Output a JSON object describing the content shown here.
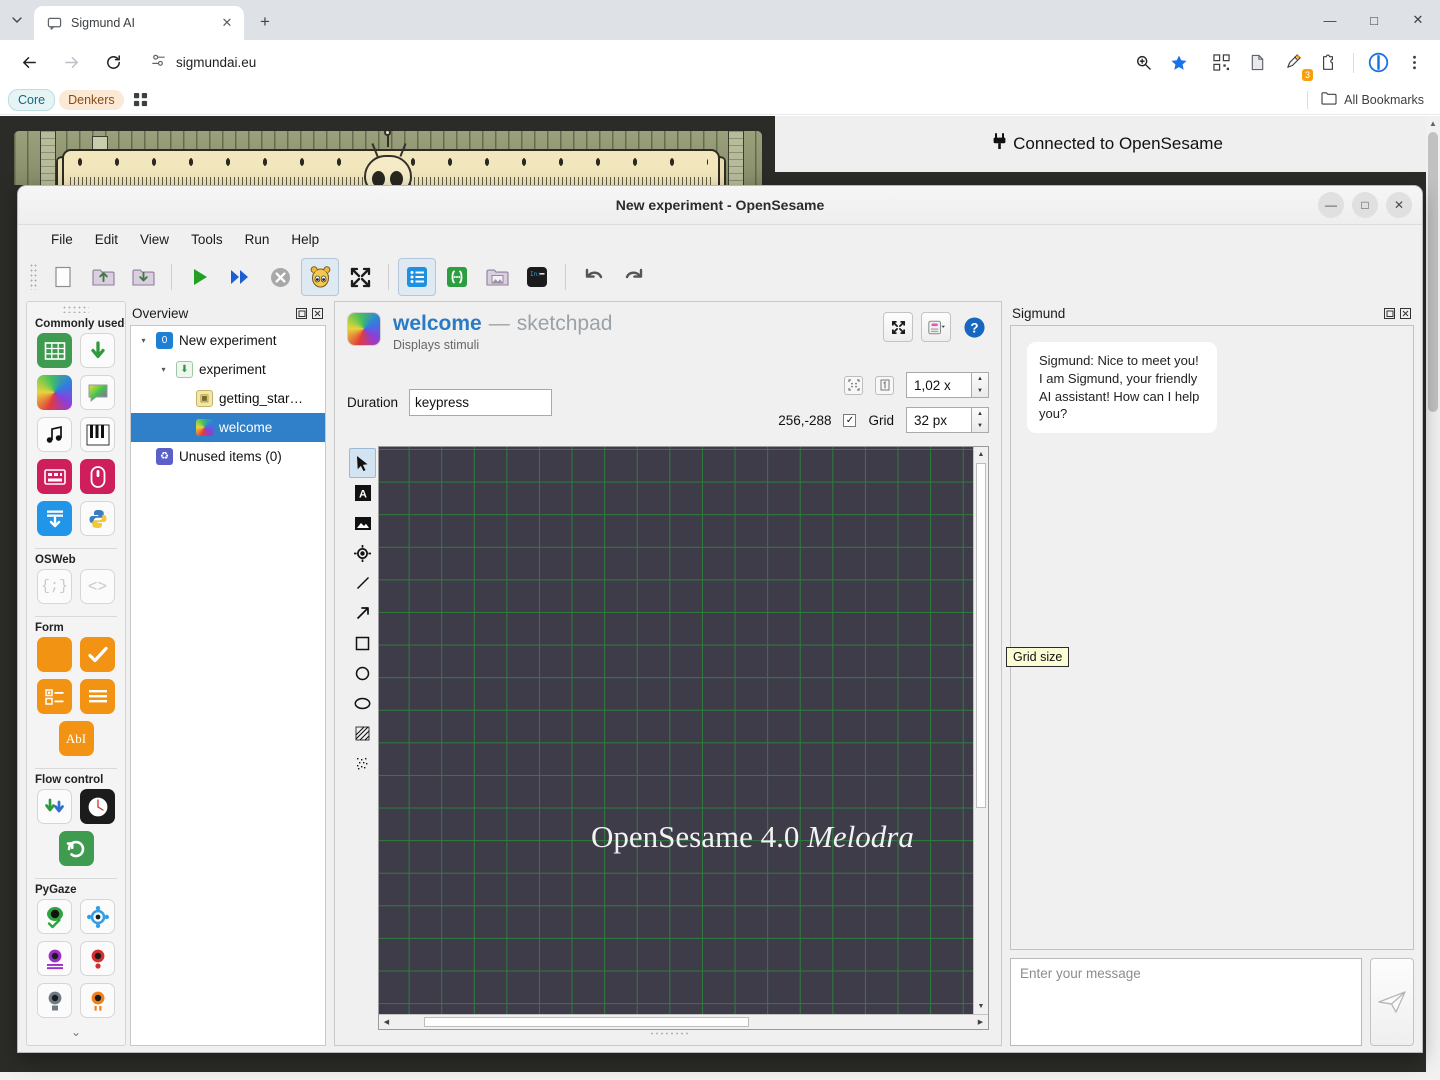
{
  "browser": {
    "tab": {
      "title": "Sigmund AI",
      "favicon_icon": "chat-bubble-icon",
      "close_icon": "close-icon"
    },
    "new_tab_label": "+",
    "tabstrip_menu_icon": "chevron-down-icon",
    "window_controls": {
      "minimize": "—",
      "maximize": "□",
      "close": "✕"
    },
    "nav": {
      "back_icon": "arrow-left-icon",
      "forward_icon": "arrow-right-icon",
      "reload_icon": "reload-icon"
    },
    "omnibox": {
      "site_settings_icon": "tune-icon",
      "url": "sigmundai.eu"
    },
    "toolbar_icons": [
      "zoom-icon",
      "bookmark-star-icon",
      "qr-code-icon",
      "reading-list-icon",
      "extension-highlight-icon",
      "extensions-puzzle-icon",
      "profile-icon",
      "more-vertical-icon"
    ],
    "extension_badge_count": "3",
    "bookmarks": [
      {
        "label": "Core",
        "style": "core"
      },
      {
        "label": "Denkers",
        "style": "denkers"
      }
    ],
    "bookmarks_grid_icon": "apps-grid-icon",
    "all_bookmarks": {
      "label": "All Bookmarks",
      "icon": "folder-icon"
    }
  },
  "page": {
    "banner": {
      "icon": "plug-icon",
      "text": "Connected to OpenSesame"
    },
    "illustration_name": "sigmund-couch-illustration"
  },
  "os_window": {
    "title": "New experiment - OpenSesame",
    "window_controls": {
      "minimize": "—",
      "maximize": "□",
      "close": "✕"
    },
    "menus": [
      "File",
      "Edit",
      "View",
      "Tools",
      "Run",
      "Help"
    ],
    "toolbar": [
      {
        "name": "new-file-button",
        "icon": "blank-page-icon"
      },
      {
        "name": "open-file-button",
        "icon": "folder-up-icon"
      },
      {
        "name": "save-file-button",
        "icon": "folder-down-icon"
      },
      {
        "name": "run-fullscreen-button",
        "icon": "play-icon"
      },
      {
        "name": "run-in-window-button",
        "icon": "fast-forward-icon"
      },
      {
        "name": "quit-button",
        "icon": "stop-x-icon"
      },
      {
        "name": "debug-window-button",
        "icon": "osdoc-bee-icon"
      },
      {
        "name": "fullscreen-button",
        "icon": "expand-arrows-icon"
      },
      {
        "name": "overview-toggle-button",
        "icon": "list-blue-icon"
      },
      {
        "name": "variable-inspector-button",
        "icon": "brackets-green-icon"
      },
      {
        "name": "file-pool-button",
        "icon": "folder-image-icon"
      },
      {
        "name": "console-button",
        "icon": "terminal-icon"
      },
      {
        "name": "undo-button",
        "icon": "undo-icon"
      },
      {
        "name": "redo-button",
        "icon": "redo-icon"
      }
    ],
    "toolbox": {
      "categories": [
        {
          "name": "Commonly used",
          "items": [
            {
              "name": "loop-item",
              "icon": "green-table-icon",
              "bg": "#3f9b4f",
              "glyph": "▦"
            },
            {
              "name": "sequence-item",
              "icon": "green-arrow-down-icon",
              "bg": "#fbfbfb",
              "glyph": "⬇"
            },
            {
              "name": "sketchpad-item",
              "icon": "rainbow-icon",
              "bg": "rainbow",
              "glyph": ""
            },
            {
              "name": "feedback-item",
              "icon": "rainbow-bubble-icon",
              "bg": "#fbfbfb",
              "glyph": "▭"
            },
            {
              "name": "sampler-item",
              "icon": "music-note-icon",
              "bg": "#fbfbfb",
              "glyph": "♫"
            },
            {
              "name": "synth-item",
              "icon": "piano-keys-icon",
              "bg": "#fbfbfb",
              "glyph": "▐"
            },
            {
              "name": "keyboard-response-item",
              "icon": "keyboard-icon",
              "bg": "#cf1e5c",
              "glyph": "⌨"
            },
            {
              "name": "mouse-response-item",
              "icon": "mouse-icon",
              "bg": "#cf1e5c",
              "glyph": "◯"
            },
            {
              "name": "logger-item",
              "icon": "log-down-icon",
              "bg": "#2196e8",
              "glyph": "⬇"
            },
            {
              "name": "inline-script-item",
              "icon": "python-icon",
              "bg": "#fbfbfb",
              "glyph": "❦"
            }
          ]
        },
        {
          "name": "OSWeb",
          "items": [
            {
              "name": "inline-javascript-item",
              "icon": "curly-braces-icon",
              "bg": "#fbfbfb",
              "glyph": "{;}"
            },
            {
              "name": "inline-html-item",
              "icon": "angle-brackets-icon",
              "bg": "#fbfbfb",
              "glyph": "‹›"
            }
          ]
        },
        {
          "name": "Form",
          "items": [
            {
              "name": "form-base-item",
              "icon": "orange-square-icon",
              "bg": "#f39314",
              "glyph": ""
            },
            {
              "name": "form-consent-item",
              "icon": "orange-check-icon",
              "bg": "#f39314",
              "glyph": "✓"
            },
            {
              "name": "form-multiple-choice-item",
              "icon": "orange-choice-icon",
              "bg": "#f39314",
              "glyph": "≣"
            },
            {
              "name": "form-text-display-item",
              "icon": "orange-lines-icon",
              "bg": "#f39314",
              "glyph": "≡"
            },
            {
              "name": "form-text-input-item",
              "icon": "orange-abi-icon",
              "bg": "#f39314",
              "glyph": "AbI"
            }
          ]
        },
        {
          "name": "Flow control",
          "items": [
            {
              "name": "coroutines-item",
              "icon": "double-arrow-down-icon",
              "bg": "#fbfbfb",
              "glyph": "⇊"
            },
            {
              "name": "reset-feedback-item",
              "icon": "clock-icon",
              "bg": "#1b1b1b",
              "glyph": "◷"
            },
            {
              "name": "repeat-cycle-item",
              "icon": "green-loop-icon",
              "bg": "#3f9b4f",
              "glyph": "↻"
            }
          ]
        },
        {
          "name": "PyGaze",
          "items": [
            {
              "name": "pygaze-init-item",
              "icon": "eye-check-icon",
              "bg": "#fbfbfb",
              "glyph": "●"
            },
            {
              "name": "pygaze-drift-correct-item",
              "icon": "blue-target-icon",
              "bg": "#fbfbfb",
              "glyph": "◎"
            },
            {
              "name": "pygaze-log-item",
              "icon": "purple-log-icon",
              "bg": "#fbfbfb",
              "glyph": "●"
            },
            {
              "name": "pygaze-start-recording-item",
              "icon": "red-record-icon",
              "bg": "#fbfbfb",
              "glyph": "●"
            },
            {
              "name": "pygaze-stop-recording-item",
              "icon": "gray-stop-icon",
              "bg": "#fbfbfb",
              "glyph": "●"
            },
            {
              "name": "pygaze-wait-item",
              "icon": "orange-pause-icon",
              "bg": "#fbfbfb",
              "glyph": "●"
            }
          ]
        }
      ],
      "more_icon": "chevron-double-down-icon"
    },
    "overview": {
      "title": "Overview",
      "float_icon": "float-icon",
      "close_icon": "close-icon",
      "tree": [
        {
          "label": "New experiment",
          "depth": 0,
          "expander": "▾",
          "icon": "experiment-icon",
          "selected": false
        },
        {
          "label": "experiment",
          "depth": 1,
          "expander": "▾",
          "icon": "sequence-icon",
          "selected": false
        },
        {
          "label": "getting_star…",
          "depth": 2,
          "expander": "",
          "icon": "notepad-icon",
          "selected": false
        },
        {
          "label": "welcome",
          "depth": 2,
          "expander": "",
          "icon": "sketchpad-icon",
          "selected": true
        },
        {
          "label": "Unused items (0)",
          "depth": 0,
          "expander": "",
          "icon": "recycle-icon",
          "selected": false
        }
      ]
    },
    "editor": {
      "item_name": "welcome",
      "dash": "—",
      "item_type": "sketchpad",
      "description": "Displays stimuli",
      "head_buttons": [
        {
          "name": "maximize-editor-button",
          "icon": "expand-arrows-icon"
        },
        {
          "name": "view-script-button",
          "icon": "script-view-icon"
        },
        {
          "name": "help-button",
          "icon": "help-circle-icon"
        }
      ],
      "duration_label": "Duration",
      "duration_value": "keypress",
      "zoom_fit_icon": "fit-screen-icon",
      "zoom_reset_icon": "zoom-100-icon",
      "zoom_value": "1,02 x",
      "cursor_coords": "256,-288",
      "grid_checked": true,
      "grid_label": "Grid",
      "grid_value": "32 px",
      "tooltip": "Grid size",
      "tools": [
        {
          "name": "select-tool",
          "icon": "cursor-arrow-icon",
          "glyph": "➤",
          "selected": true
        },
        {
          "name": "text-tool",
          "icon": "text-a-icon",
          "glyph": "A",
          "selected": false
        },
        {
          "name": "image-tool",
          "icon": "image-icon",
          "glyph": "⛰",
          "selected": false
        },
        {
          "name": "fixation-dot-tool",
          "icon": "fixation-dot-icon",
          "glyph": "◉",
          "selected": false
        },
        {
          "name": "line-tool",
          "icon": "line-icon",
          "glyph": "╱",
          "selected": false
        },
        {
          "name": "arrow-tool",
          "icon": "arrow-icon",
          "glyph": "↗",
          "selected": false
        },
        {
          "name": "rect-tool",
          "icon": "rectangle-icon",
          "glyph": "□",
          "selected": false
        },
        {
          "name": "circle-tool",
          "icon": "circle-icon",
          "glyph": "○",
          "selected": false
        },
        {
          "name": "ellipse-tool",
          "icon": "ellipse-icon",
          "glyph": "⬭",
          "selected": false
        },
        {
          "name": "polygon-tool",
          "icon": "hatched-shape-icon",
          "glyph": "▨",
          "selected": false
        },
        {
          "name": "noise-patch-tool",
          "icon": "noise-patch-icon",
          "glyph": "░",
          "selected": false
        }
      ],
      "canvas": {
        "text_plain": "OpenSesame 4.0 ",
        "text_italic": "Melodra",
        "background_color": "#3f3c4a",
        "grid_color": "#2f7d3c",
        "text_color": "#f2f2f2"
      }
    },
    "sigmund": {
      "title": "Sigmund",
      "float_icon": "float-icon",
      "close_icon": "close-icon",
      "message": "Sigmund: Nice to meet you! I am Sigmund, your friendly AI assistant! How can I help you?",
      "input_placeholder": "Enter your message",
      "send_icon": "paper-plane-icon"
    }
  }
}
